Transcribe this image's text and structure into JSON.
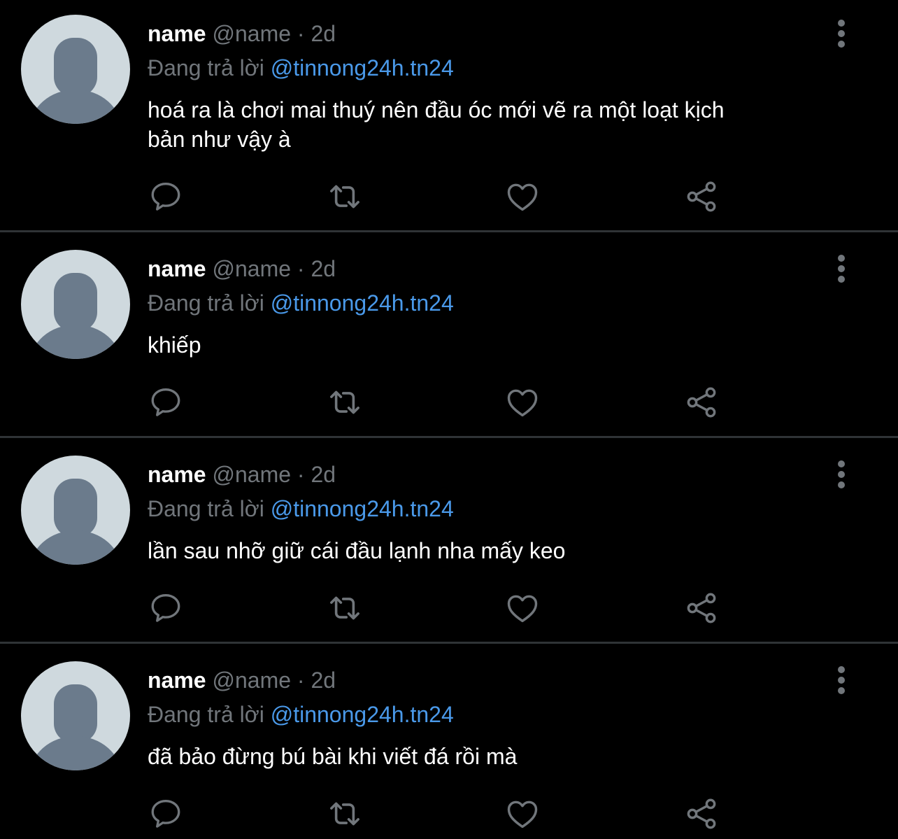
{
  "colors": {
    "background": "#000000",
    "divider": "#2f3336",
    "text_primary": "#ffffff",
    "text_secondary": "#71767b",
    "mention": "#4a99e9",
    "avatar_bg": "#cfd9de",
    "avatar_figure": "#6b7b8c"
  },
  "icons": {
    "reply": "speech-bubble-icon",
    "retweet": "retweet-icon",
    "like": "heart-icon",
    "share": "share-icon",
    "more": "vertical-ellipsis-icon"
  },
  "tweets": [
    {
      "display_name": "name",
      "handle_time": "@name · 2d",
      "reply_prefix": "Đang trả lời",
      "reply_mention": "@tinnong24h.tn24",
      "body_line_1": "hoá ra là chơi mai thuý nên đầu óc mới vẽ ra một loạt kịch",
      "body_line_2": "bản như vậy à"
    },
    {
      "display_name": "name",
      "handle_time": "@name · 2d",
      "reply_prefix": "Đang trả lời",
      "reply_mention": "@tinnong24h.tn24",
      "body_line_1": "khiếp",
      "body_line_2": ""
    },
    {
      "display_name": "name",
      "handle_time": "@name · 2d",
      "reply_prefix": "Đang trả lời",
      "reply_mention": "@tinnong24h.tn24",
      "body_line_1": "lần sau nhỡ giữ cái đầu lạnh nha mấy keo",
      "body_line_2": ""
    },
    {
      "display_name": "name",
      "handle_time": "@name · 2d",
      "reply_prefix": "Đang trả lời",
      "reply_mention": "@tinnong24h.tn24",
      "body_line_1": "đã bảo đừng bú bài khi viết đá rồi mà",
      "body_line_2": ""
    }
  ]
}
